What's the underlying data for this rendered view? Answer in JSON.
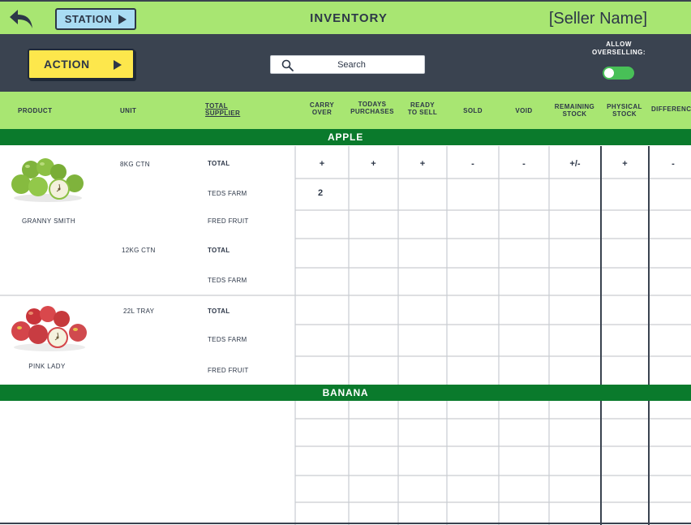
{
  "topbar": {
    "station_label": "STATION",
    "title": "INVENTORY",
    "seller_name": "[Seller Name]"
  },
  "toolbar": {
    "action_label": "ACTION",
    "search_placeholder": "Search",
    "allow_overselling_line1": "ALLOW",
    "allow_overselling_line2": "OVERSELLING:",
    "allow_overselling_on": true
  },
  "columns": {
    "product": "PRODUCT",
    "unit": "UNIT",
    "supplier_l1": "TOTAL",
    "supplier_l2": "SUPPLIER",
    "carry_l1": "CARRY",
    "carry_l2": "OVER",
    "todays_l1": "TODAYS",
    "todays_l2": "PURCHASES",
    "ready_l1": "READY",
    "ready_l2": "TO SELL",
    "sold": "SOLD",
    "void": "VOID",
    "remaining_l1": "REMAINING",
    "remaining_l2": "STOCK",
    "physical_l1": "PHYSICAL",
    "physical_l2": "STOCK",
    "difference": "DIFFERENCE"
  },
  "categories": [
    {
      "name": "APPLE"
    },
    {
      "name": "BANANA"
    }
  ],
  "products": [
    {
      "name": "GRANNY SMITH",
      "image_icon": "green-apples-image",
      "units": [
        {
          "unit": "8KG CTN",
          "rows": [
            {
              "supplier": "TOTAL",
              "bold": true,
              "values": [
                "+",
                "+",
                "+",
                "-",
                "-",
                "+/-",
                "+",
                "-"
              ]
            },
            {
              "supplier": "TEDS FARM",
              "bold": false,
              "values": [
                "2",
                "",
                "",
                "",
                "",
                "",
                "",
                ""
              ]
            },
            {
              "supplier": "FRED FRUIT",
              "bold": false,
              "values": [
                "",
                "",
                "",
                "",
                "",
                "",
                "",
                ""
              ]
            }
          ]
        },
        {
          "unit": "12KG CTN",
          "rows": [
            {
              "supplier": "TOTAL",
              "bold": true,
              "values": [
                "",
                "",
                "",
                "",
                "",
                "",
                "",
                ""
              ]
            },
            {
              "supplier": "TEDS FARM",
              "bold": false,
              "values": [
                "",
                "",
                "",
                "",
                "",
                "",
                "",
                ""
              ]
            }
          ]
        }
      ]
    },
    {
      "name": "PINK LADY",
      "image_icon": "red-apples-image",
      "units": [
        {
          "unit": "22L TRAY",
          "rows": [
            {
              "supplier": "TOTAL",
              "bold": true,
              "values": [
                "",
                "",
                "",
                "",
                "",
                "",
                "",
                ""
              ]
            },
            {
              "supplier": "TEDS FARM",
              "bold": false,
              "values": [
                "",
                "",
                "",
                "",
                "",
                "",
                "",
                ""
              ]
            },
            {
              "supplier": "FRED FRUIT",
              "bold": false,
              "values": [
                "",
                "",
                "",
                "",
                "",
                "",
                "",
                ""
              ]
            }
          ]
        }
      ]
    }
  ],
  "colors": {
    "header_green": "#a8e672",
    "dark_bar": "#3a4350",
    "category_green": "#0a7a2c",
    "action_yellow": "#fde74c",
    "station_blue": "#a9dcf3",
    "toggle_green": "#48c057"
  }
}
